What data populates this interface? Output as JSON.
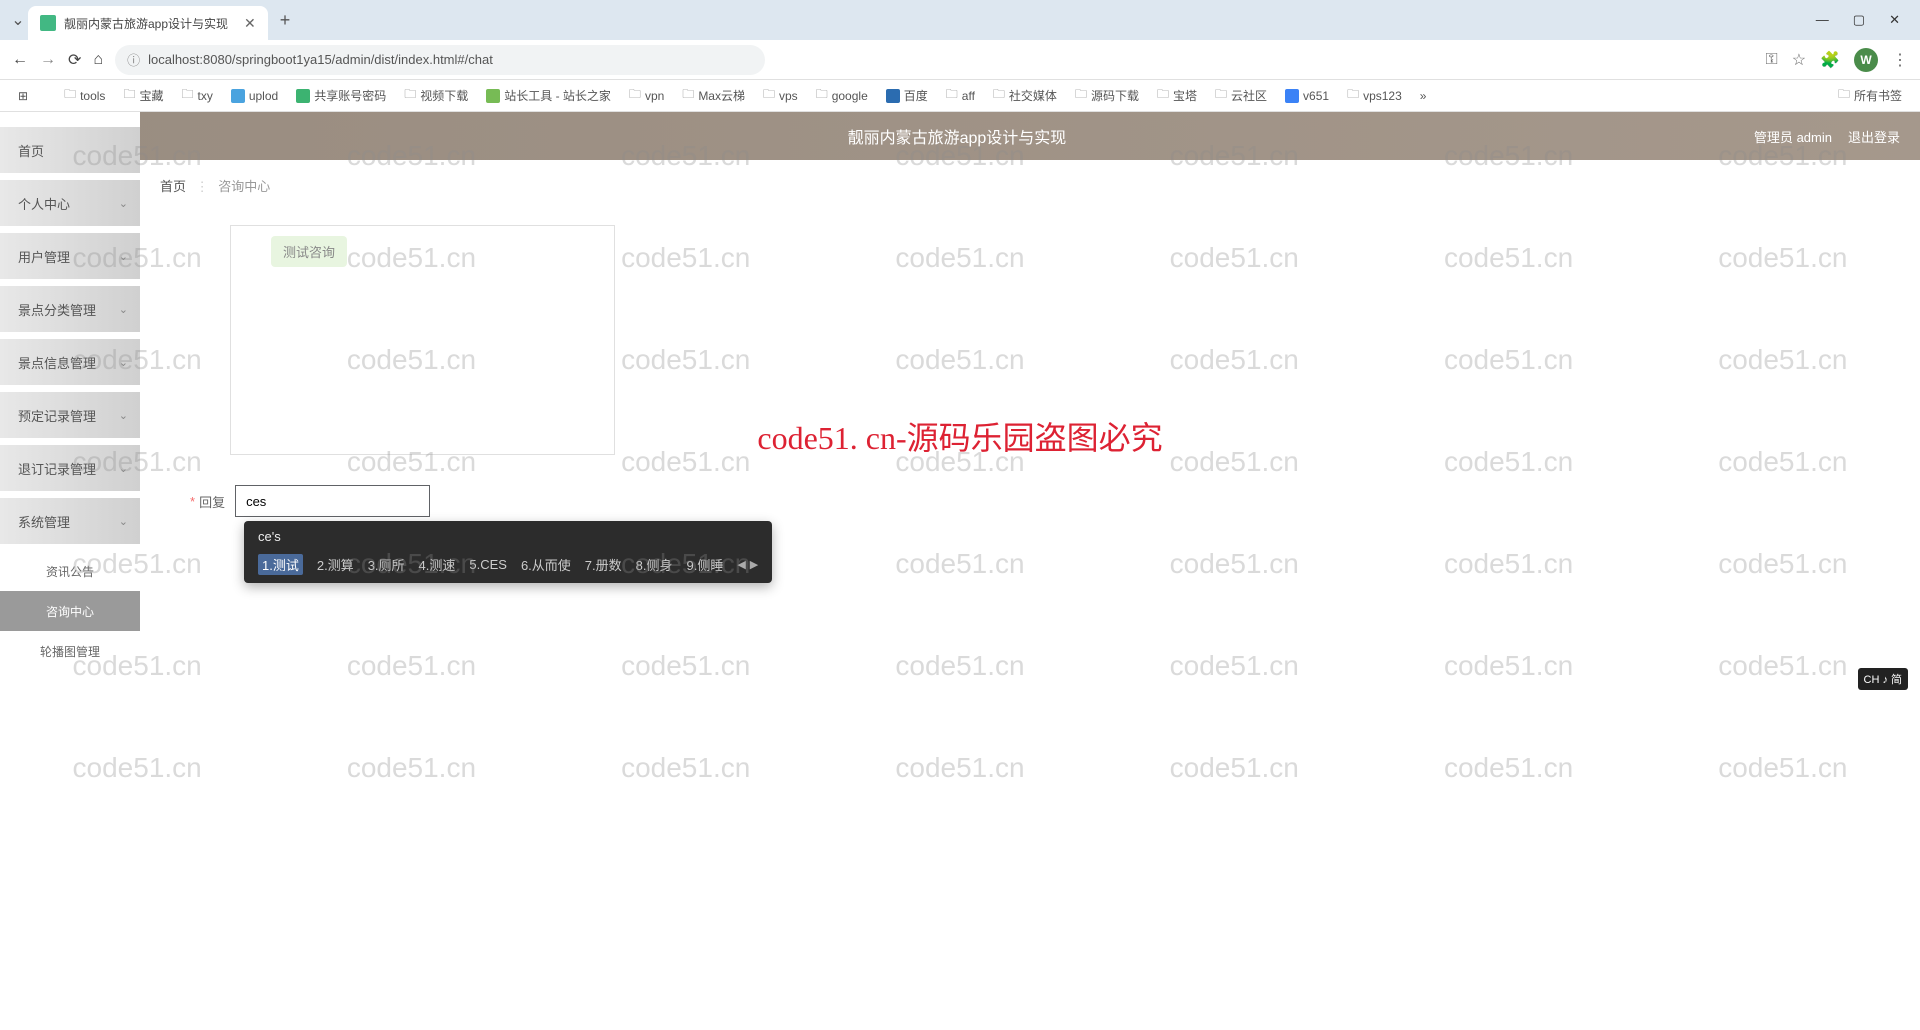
{
  "browser": {
    "tab_title": "靓丽内蒙古旅游app设计与实现",
    "url": "localhost:8080/springboot1ya15/admin/dist/index.html#/chat",
    "avatar_letter": "W",
    "window_min": "—",
    "window_max": "▢",
    "window_close": "✕",
    "new_tab": "+",
    "tab_close": "✕",
    "all_bookmarks": "所有书签"
  },
  "bookmarks": [
    {
      "type": "grid",
      "label": ""
    },
    {
      "type": "folder",
      "label": "tools"
    },
    {
      "type": "folder",
      "label": "宝藏"
    },
    {
      "type": "folder",
      "label": "txy"
    },
    {
      "type": "icon",
      "label": "uplod",
      "color": "#4aa3df"
    },
    {
      "type": "icon",
      "label": "共享账号密码",
      "color": "#3cb371"
    },
    {
      "type": "folder",
      "label": "视频下载"
    },
    {
      "type": "icon",
      "label": "站长工具 - 站长之家",
      "color": "#7b5"
    },
    {
      "type": "folder",
      "label": "vpn"
    },
    {
      "type": "folder",
      "label": "Max云梯"
    },
    {
      "type": "folder",
      "label": "vps"
    },
    {
      "type": "folder",
      "label": "google"
    },
    {
      "type": "icon",
      "label": "百度",
      "color": "#2b6cb0"
    },
    {
      "type": "folder",
      "label": "aff"
    },
    {
      "type": "folder",
      "label": "社交媒体"
    },
    {
      "type": "folder",
      "label": "源码下载"
    },
    {
      "type": "folder",
      "label": "宝塔"
    },
    {
      "type": "folder",
      "label": "云社区"
    },
    {
      "type": "icon",
      "label": "v651",
      "color": "#3b82f6"
    },
    {
      "type": "folder",
      "label": "vps123"
    }
  ],
  "sidebar": {
    "items": [
      {
        "label": "首页",
        "expandable": false
      },
      {
        "label": "个人中心",
        "expandable": true
      },
      {
        "label": "用户管理",
        "expandable": true
      },
      {
        "label": "景点分类管理",
        "expandable": true
      },
      {
        "label": "景点信息管理",
        "expandable": true
      },
      {
        "label": "预定记录管理",
        "expandable": true
      },
      {
        "label": "退订记录管理",
        "expandable": true
      },
      {
        "label": "系统管理",
        "expandable": true
      }
    ],
    "subs": [
      {
        "label": "资讯公告",
        "active": false
      },
      {
        "label": "咨询中心",
        "active": true
      },
      {
        "label": "轮播图管理",
        "active": false
      }
    ]
  },
  "header": {
    "app_title": "靓丽内蒙古旅游app设计与实现",
    "user_role": "管理员",
    "user_name": "admin",
    "logout": "退出登录"
  },
  "breadcrumb": {
    "home": "首页",
    "current": "咨询中心"
  },
  "chat": {
    "message": "测试咨询"
  },
  "reply": {
    "label": "回复",
    "value": "ces"
  },
  "ime": {
    "input": "ce's",
    "candidates": [
      "1.测试",
      "2.测算",
      "3.厕所",
      "4.测速",
      "5.CES",
      "6.从而使",
      "7.册数",
      "8.侧身",
      "9.侧睡"
    ],
    "indicator": "CH ♪ 简"
  },
  "watermark": {
    "text": "code51.cn",
    "center_text": "code51. cn-源码乐园盗图必究"
  }
}
